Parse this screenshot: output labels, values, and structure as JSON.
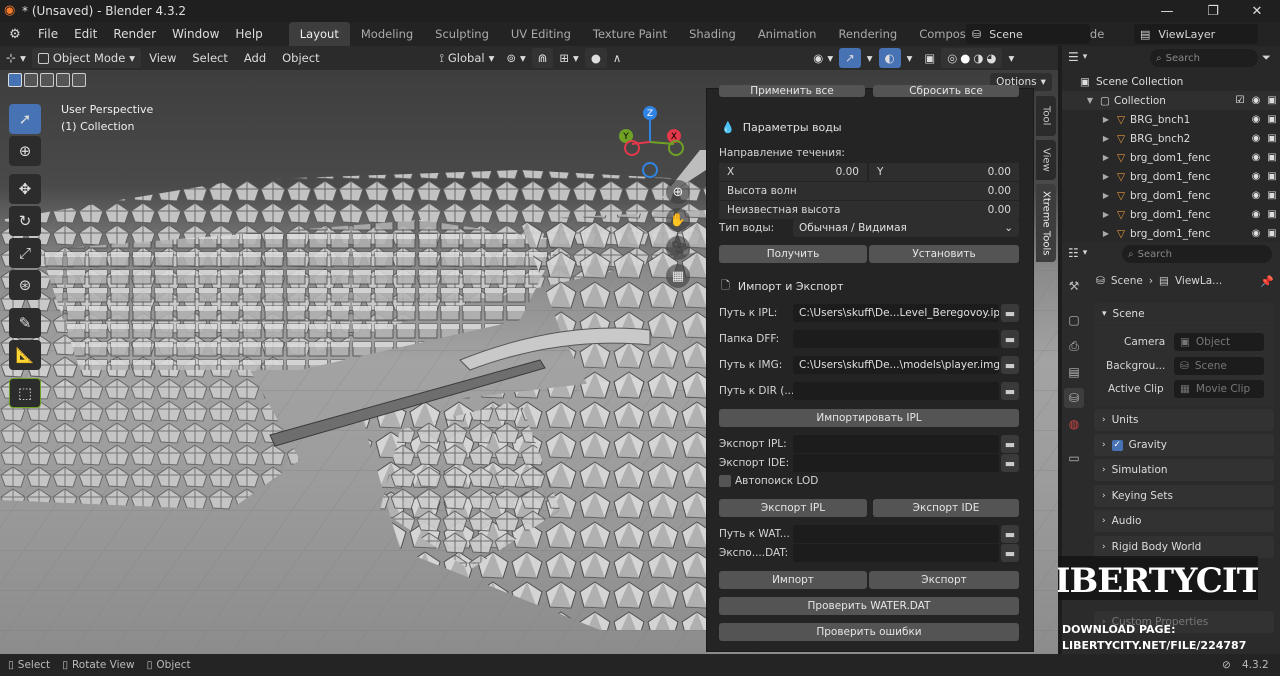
{
  "window": {
    "title": "* (Unsaved) - Blender 4.3.2",
    "min": "—",
    "max": "❐",
    "close": "✕"
  },
  "menu": [
    "File",
    "Edit",
    "Render",
    "Window",
    "Help"
  ],
  "workspaces": [
    "Layout",
    "Modeling",
    "Sculpting",
    "UV Editing",
    "Texture Paint",
    "Shading",
    "Animation",
    "Rendering",
    "Compositing",
    "Geometry Node"
  ],
  "scene_selector": "Scene",
  "viewlayer_selector": "ViewLayer",
  "viewport_header": {
    "mode": "Object Mode",
    "menus": [
      "View",
      "Select",
      "Add",
      "Object"
    ],
    "transform": "Global",
    "options": "Options"
  },
  "viewport": {
    "perspective": "User Perspective",
    "collection": "(1) Collection",
    "gizmo": {
      "z": "Z",
      "y": "Y",
      "x": "X"
    }
  },
  "npanel": {
    "top_buttons": [
      "Применить все",
      "Сбросить все"
    ],
    "water_params": {
      "title": "Параметры воды",
      "flow_label": "Направление течения:",
      "x_label": "X",
      "x_value": "0.00",
      "y_label": "Y",
      "y_value": "0.00",
      "wave_label": "Высота волн",
      "wave_value": "0.00",
      "unknown_label": "Неизвестная высота",
      "unknown_value": "0.00",
      "type_label": "Тип воды:",
      "type_value": "Обычная / Видимая",
      "get_button": "Получить",
      "set_button": "Установить"
    },
    "import_export": {
      "title": "Импорт и Экспорт",
      "ipl_label": "Путь к IPL:",
      "ipl_value": "C:\\Users\\skuff\\De...Level_Beregovoy.ipl",
      "dff_label": "Папка DFF:",
      "dff_value": "",
      "img_label": "Путь к IMG:",
      "img_value": "C:\\Users\\skuff\\De...\\models\\player.img",
      "dir_label": "Путь к DIR (...",
      "dir_value": "",
      "import_ipl_button": "Импортировать IPL",
      "export_ipl_label": "Экспорт IPL:",
      "export_ipl_value": "",
      "export_ide_label": "Экспорт IDE:",
      "export_ide_value": "",
      "autolod_label": "Автопоиск LOD",
      "export_ipl_button": "Экспорт IPL",
      "export_ide_button": "Экспорт IDE",
      "water_path_label": "Путь к WAT...",
      "water_path_value": "",
      "export_dat_label": "Экспо....DAT:",
      "export_dat_value": "",
      "import_button": "Импорт",
      "export_button": "Экспорт",
      "check_water_button": "Проверить WATER.DAT",
      "check_errors_button": "Проверить ошибки"
    },
    "side_tabs": [
      "Tool",
      "View",
      "Xtreme Tools"
    ]
  },
  "outliner": {
    "search_placeholder": "Search",
    "scene_collection": "Scene Collection",
    "collection": "Collection",
    "items": [
      "BRG_bnch1",
      "BRG_bnch2",
      "brg_dom1_fenc",
      "brg_dom1_fenc",
      "brg_dom1_fenc",
      "brg_dom1_fenc",
      "brg_dom1_fenc"
    ]
  },
  "properties": {
    "search_placeholder": "Search",
    "breadcrumb_scene": "Scene",
    "breadcrumb_layer": "ViewLa...",
    "scene_section": "Scene",
    "camera_label": "Camera",
    "camera_value": "Object",
    "background_label": "Backgrou...",
    "background_value": "Scene",
    "clip_label": "Active Clip",
    "clip_value": "Movie Clip",
    "sections": [
      "Units",
      "Gravity",
      "Simulation",
      "Keying Sets",
      "Audio",
      "Rigid Body World"
    ],
    "partial_section": "Custom Properties"
  },
  "watermark": {
    "logo": "LIBERTYCITY",
    "line1": "DOWNLOAD PAGE:",
    "line2": "LIBERTYCITY.NET/FILE/224787"
  },
  "status": {
    "select": "Select",
    "rotate": "Rotate View",
    "object": "Object",
    "version": "4.3.2"
  },
  "colors": {
    "accent": "#4772b3",
    "gizmo_x": "#e2394b",
    "gizmo_y": "#6fa224",
    "gizmo_z": "#2f83e3",
    "object_icon": "#e89a3c"
  }
}
